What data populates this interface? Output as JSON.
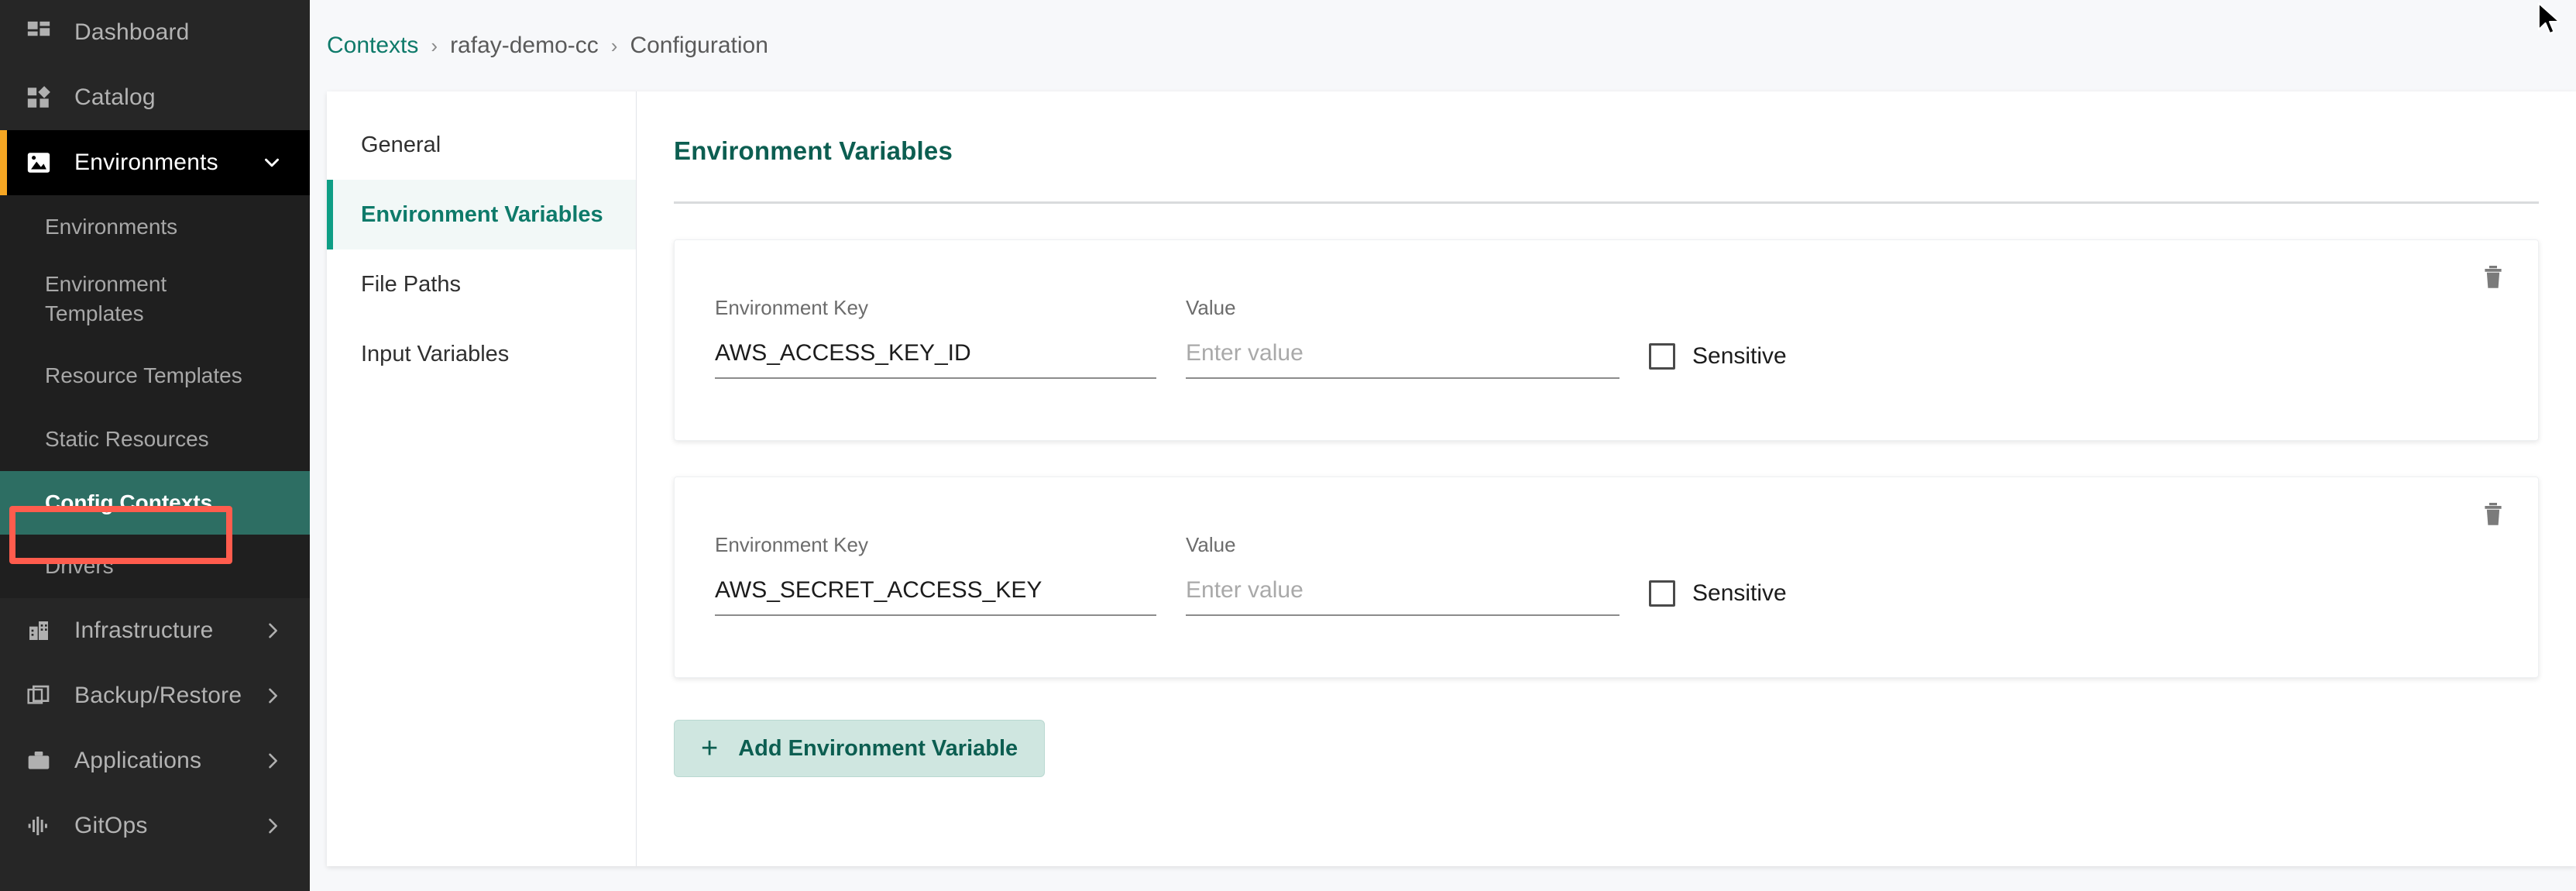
{
  "sidebar": {
    "items": [
      {
        "label": "Dashboard",
        "icon": "dashboard-grid-icon",
        "type": "top",
        "state": "normal",
        "chevron": ""
      },
      {
        "label": "Catalog",
        "icon": "catalog-shapes-icon",
        "type": "top",
        "state": "normal",
        "chevron": ""
      },
      {
        "label": "Environments",
        "icon": "environments-image-icon",
        "type": "top",
        "state": "active-expanded",
        "chevron": "chevron-down-icon"
      },
      {
        "label": "Environments",
        "icon": "",
        "type": "sub",
        "state": "normal",
        "chevron": ""
      },
      {
        "label": "Environment Templates",
        "icon": "",
        "type": "sub-two-line",
        "state": "normal",
        "chevron": ""
      },
      {
        "label": "Resource Templates",
        "icon": "",
        "type": "sub",
        "state": "normal",
        "chevron": ""
      },
      {
        "label": "Static Resources",
        "icon": "",
        "type": "sub",
        "state": "normal",
        "chevron": ""
      },
      {
        "label": "Config Contexts",
        "icon": "",
        "type": "sub",
        "state": "selected-highlighted",
        "chevron": ""
      },
      {
        "label": "Drivers",
        "icon": "",
        "type": "sub",
        "state": "normal",
        "chevron": ""
      },
      {
        "label": "Infrastructure",
        "icon": "infrastructure-building-icon",
        "type": "top",
        "state": "normal",
        "chevron": "chevron-right-icon"
      },
      {
        "label": "Backup/Restore",
        "icon": "backup-restore-layers-icon",
        "type": "top",
        "state": "normal",
        "chevron": "chevron-right-icon"
      },
      {
        "label": "Applications",
        "icon": "applications-briefcase-icon",
        "type": "top",
        "state": "normal",
        "chevron": "chevron-right-icon"
      },
      {
        "label": "GitOps",
        "icon": "gitops-waveform-icon",
        "type": "top",
        "state": "normal",
        "chevron": "chevron-right-icon"
      }
    ]
  },
  "breadcrumb": {
    "root": "Contexts",
    "separator": "›",
    "context": "rafay-demo-cc",
    "current": "Configuration"
  },
  "tabs": [
    {
      "label": "General",
      "active": false
    },
    {
      "label": "Environment Variables",
      "active": true
    },
    {
      "label": "File Paths",
      "active": false
    },
    {
      "label": "Input Variables",
      "active": false
    }
  ],
  "content": {
    "title": "Environment Variables",
    "add_button_label": "Add Environment Variable",
    "add_button_icon": "plus-icon",
    "variables": [
      {
        "key_label": "Environment Key",
        "key_value": "AWS_ACCESS_KEY_ID",
        "value_label": "Value",
        "value_value": "",
        "value_placeholder": "Enter value",
        "sensitive_label": "Sensitive",
        "sensitive_checked": false,
        "delete_icon": "trash-icon"
      },
      {
        "key_label": "Environment Key",
        "key_value": "AWS_SECRET_ACCESS_KEY",
        "value_label": "Value",
        "value_value": "",
        "value_placeholder": "Enter value",
        "sensitive_label": "Sensitive",
        "sensitive_checked": false,
        "delete_icon": "trash-icon"
      }
    ]
  },
  "colors": {
    "sidebar_bg": "#262626",
    "sidebar_sub_bg": "#1f1f1f",
    "active_group_bg": "#000000",
    "active_accent": "#f5a623",
    "selected_teal": "#2d6e63",
    "annotation_red": "#ff5c4d",
    "brand_teal": "#0e7a6a",
    "title_teal": "#0c5e51",
    "add_button_bg": "#cfe6e0",
    "main_bg": "#f7f8fa"
  },
  "cursor": {
    "icon": "mouse-pointer-arrow-icon"
  }
}
